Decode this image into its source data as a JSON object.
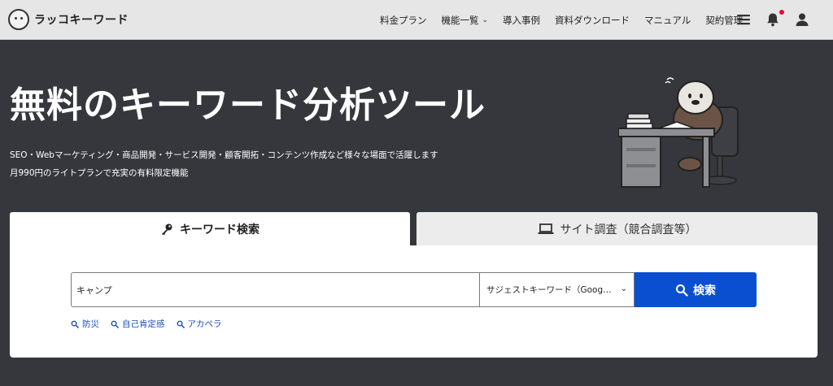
{
  "header": {
    "logo_text": "ラッコキーワード",
    "nav": [
      {
        "label": "料金プラン"
      },
      {
        "label": "機能一覧",
        "has_dropdown": true
      },
      {
        "label": "導入事例"
      },
      {
        "label": "資料ダウンロード"
      },
      {
        "label": "マニュアル"
      },
      {
        "label": "契約管理"
      }
    ],
    "icons": [
      "menu-icon",
      "bell-icon",
      "user-icon"
    ],
    "notification_dot_color": "#e0102f"
  },
  "hero": {
    "title": "無料のキーワード分析ツール",
    "subtitle_1": "SEO・Webマーケティング・商品開発・サービス開発・顧客開拓・コンテンツ作成など様々な場面で活躍します",
    "subtitle_2": "月990円のライトプランで充実の有料限定機能"
  },
  "tabs": {
    "keyword": "キーワード検索",
    "site": "サイト調査（競合調査等）"
  },
  "search": {
    "value": "キャンプ",
    "placeholder": "",
    "select_value": "サジェストキーワード（Google）",
    "button_label": "検索"
  },
  "related": [
    "防災",
    "自己肯定感",
    "アカペラ"
  ],
  "colors": {
    "background": "#36373c",
    "header": "#e6e6e6",
    "primary": "#0b4fd1",
    "link": "#1a4fb8"
  }
}
